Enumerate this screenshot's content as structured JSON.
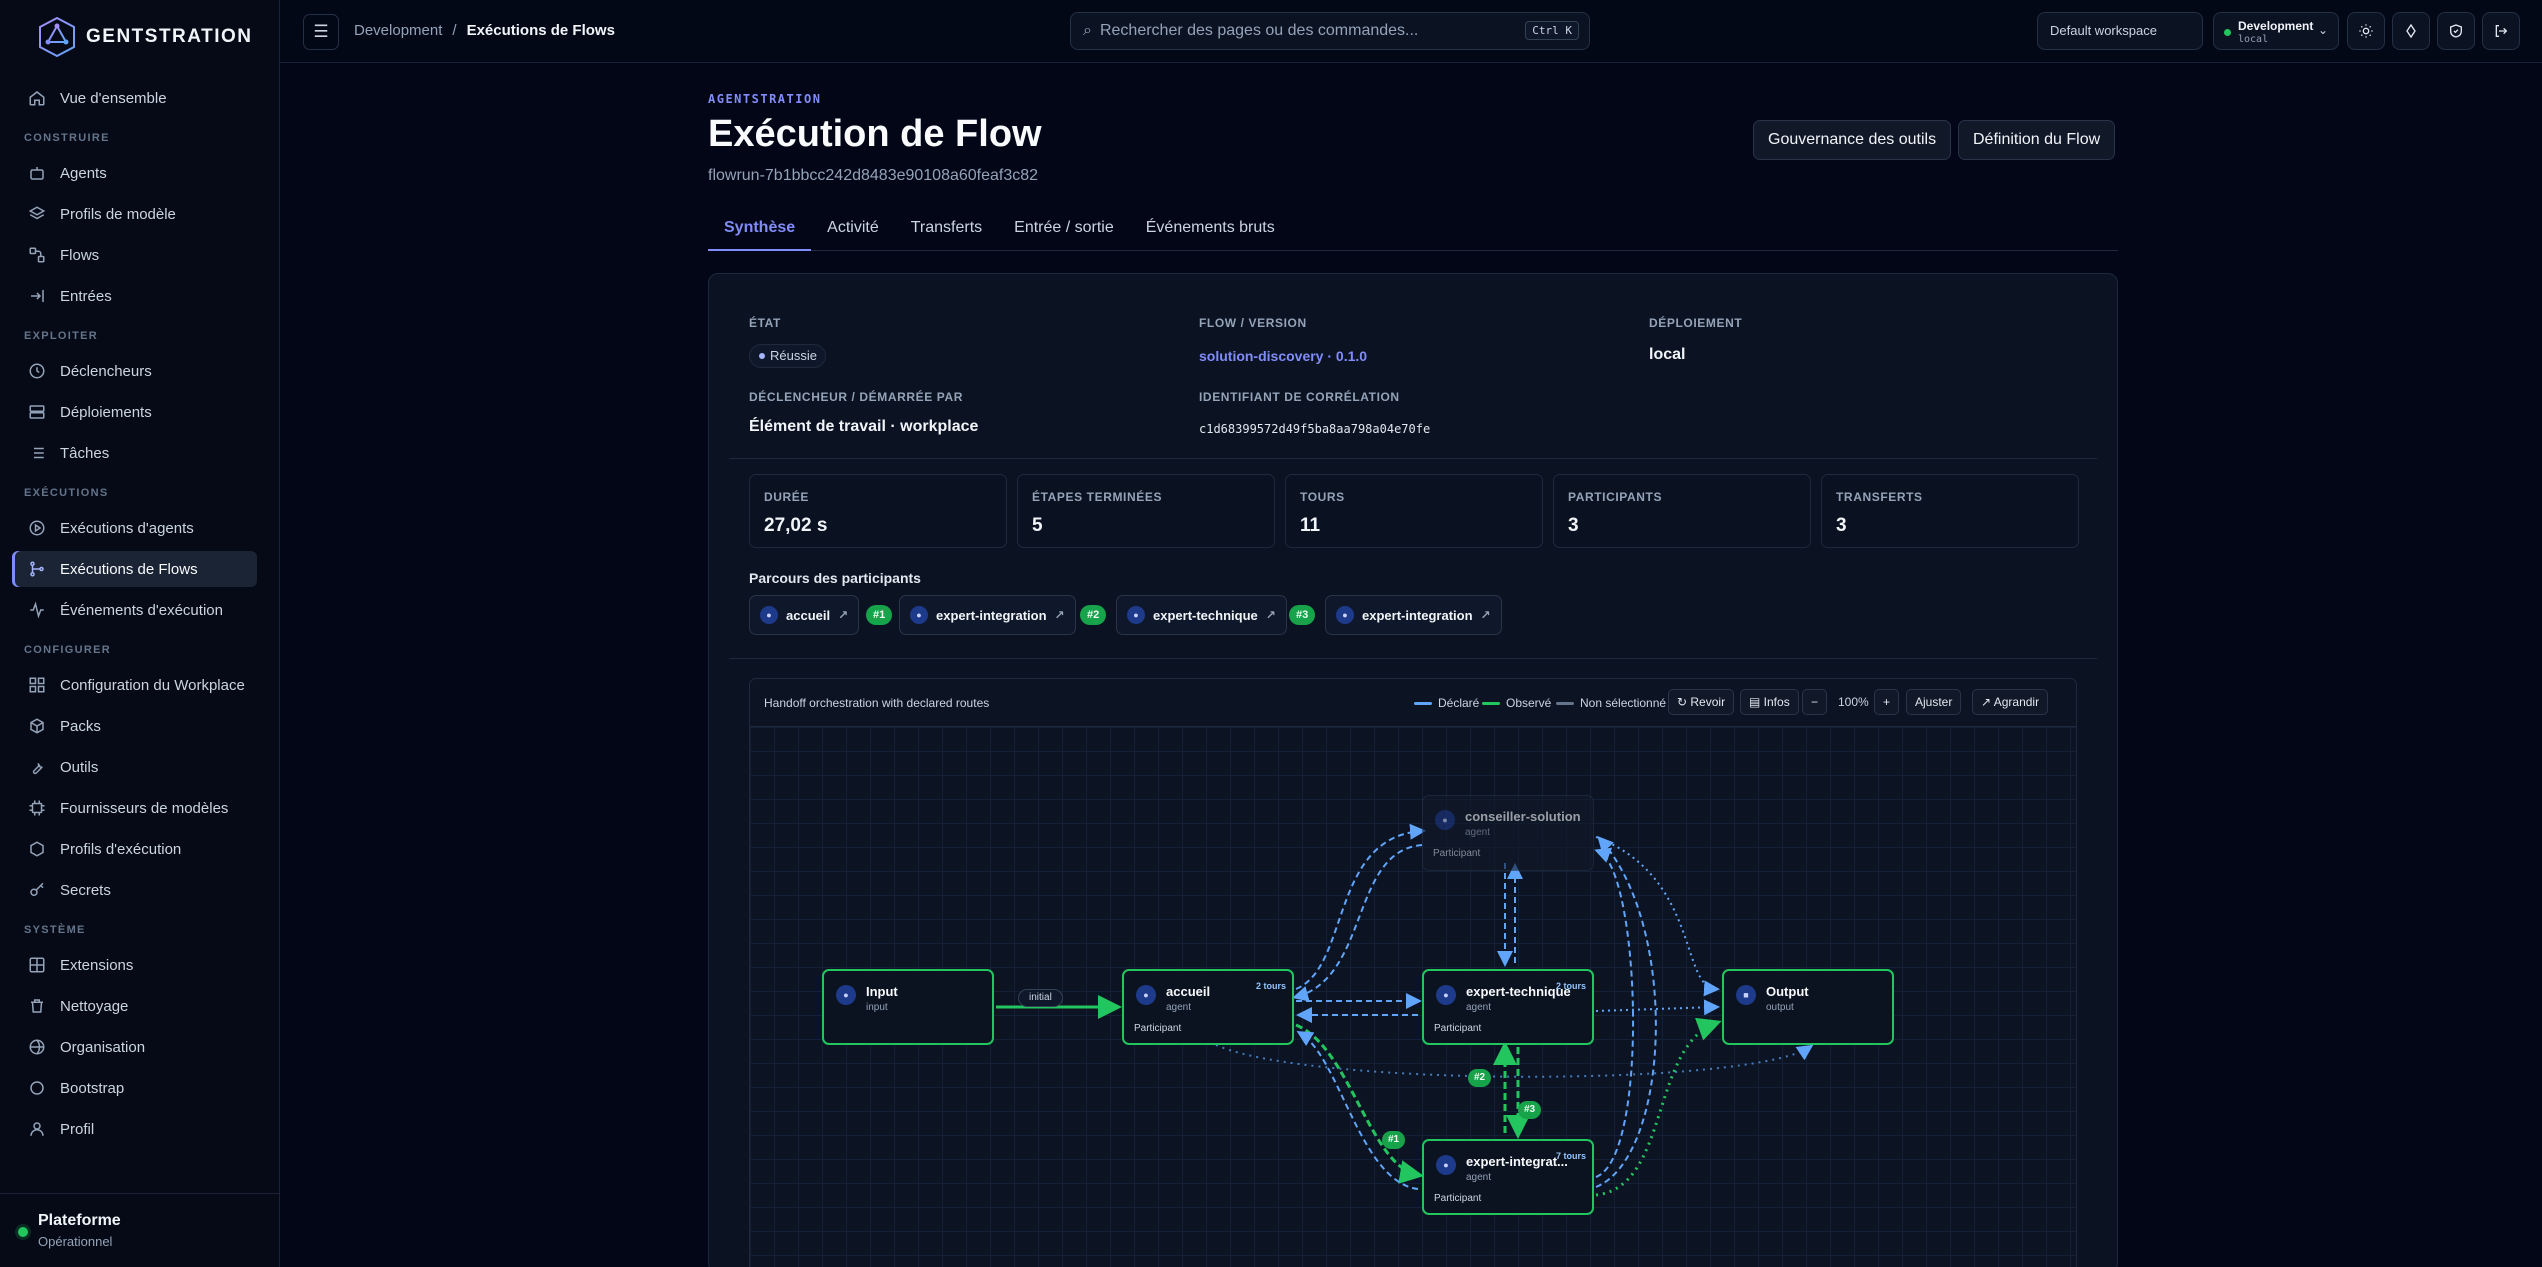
{
  "brand": {
    "name": "GENTSTRATION"
  },
  "sidebar": {
    "top": [
      {
        "label": "Vue d'ensemble",
        "icon": "home-icon"
      }
    ],
    "sections": [
      {
        "title": "CONSTRUIRE",
        "items": [
          {
            "label": "Agents",
            "icon": "bot-icon"
          },
          {
            "label": "Profils de modèle",
            "icon": "layers-icon"
          },
          {
            "label": "Flows",
            "icon": "workflow-icon"
          },
          {
            "label": "Entrées",
            "icon": "log-in-icon"
          }
        ]
      },
      {
        "title": "EXPLOITER",
        "items": [
          {
            "label": "Déclencheurs",
            "icon": "clock-icon"
          },
          {
            "label": "Déploiements",
            "icon": "server-icon"
          },
          {
            "label": "Tâches",
            "icon": "list-icon"
          }
        ]
      },
      {
        "title": "EXÉCUTIONS",
        "items": [
          {
            "label": "Exécutions d'agents",
            "icon": "play-circle-icon"
          },
          {
            "label": "Exécutions de Flows",
            "icon": "git-branch-icon",
            "active": true
          },
          {
            "label": "Événements d'exécution",
            "icon": "activity-icon"
          }
        ]
      },
      {
        "title": "CONFIGURER",
        "items": [
          {
            "label": "Configuration du Workplace",
            "icon": "grid-icon"
          },
          {
            "label": "Packs",
            "icon": "package-icon"
          },
          {
            "label": "Outils",
            "icon": "wrench-icon"
          },
          {
            "label": "Fournisseurs de modèles",
            "icon": "cpu-icon"
          },
          {
            "label": "Profils d'exécution",
            "icon": "box-icon"
          },
          {
            "label": "Secrets",
            "icon": "key-icon"
          }
        ]
      },
      {
        "title": "SYSTÈME",
        "items": [
          {
            "label": "Extensions",
            "icon": "puzzle-icon"
          },
          {
            "label": "Nettoyage",
            "icon": "trash-icon"
          },
          {
            "label": "Organisation",
            "icon": "building-icon"
          },
          {
            "label": "Bootstrap",
            "icon": "circle-icon"
          },
          {
            "label": "Profil",
            "icon": "user-icon"
          }
        ]
      }
    ],
    "platform": {
      "name": "Plateforme",
      "status": "Opérationnel"
    }
  },
  "topbar": {
    "menu_glyph": "☰",
    "breadcrumb": {
      "parent": "Development",
      "sep": "/",
      "current": "Exécutions de Flows"
    },
    "search": {
      "placeholder": "Rechercher des pages ou des commandes...",
      "glyph": "⌕",
      "shortcut": "Ctrl K"
    },
    "workspace": "Default workspace",
    "environment": {
      "name": "Development",
      "sub": "local",
      "chevron": "⌄"
    }
  },
  "page": {
    "eyebrow": "AGENTSTRATION",
    "title": "Exécution de Flow",
    "run_id": "flowrun-7b1bbcc242d8483e90108a60feaf3c82",
    "actions": {
      "governance": "Gouvernance des outils",
      "definition": "Définition du Flow"
    },
    "tabs": [
      "Synthèse",
      "Activité",
      "Transferts",
      "Entrée / sortie",
      "Événements bruts"
    ]
  },
  "details": {
    "state_label": "ÉTAT",
    "state_value": "Réussie",
    "flow_label": "FLOW / VERSION",
    "flow_value": "solution-discovery · 0.1.0",
    "deploy_label": "DÉPLOIEMENT",
    "deploy_value": "local",
    "trigger_label": "DÉCLENCHEUR / DÉMARRÉE PAR",
    "trigger_value": "Élément de travail · workplace",
    "corr_label": "IDENTIFIANT DE CORRÉLATION",
    "corr_value": "c1d68399572d49f5ba8aa798a04e70fe"
  },
  "stats": [
    {
      "label": "DURÉE",
      "value": "27,02 s"
    },
    {
      "label": "ÉTAPES TERMINÉES",
      "value": "5"
    },
    {
      "label": "TOURS",
      "value": "11"
    },
    {
      "label": "PARTICIPANTS",
      "value": "3"
    },
    {
      "label": "TRANSFERTS",
      "value": "3"
    }
  ],
  "journey": {
    "title": "Parcours des participants",
    "arrow_glyph": "↗",
    "chips": [
      "accueil",
      "expert-integration",
      "expert-technique",
      "expert-integration"
    ],
    "steps": [
      "#1",
      "#2",
      "#3"
    ]
  },
  "graph": {
    "title": "Handoff orchestration with declared routes",
    "legend": {
      "declared": "Déclaré",
      "observed": "Observé",
      "unselected": "Non sélectionné"
    },
    "buttons": {
      "review": "↻ Revoir",
      "info": "▤ Infos",
      "zoom_out": "−",
      "zoom": "100%",
      "zoom_in": "+",
      "fit": "Ajuster",
      "expand": "↗ Agrandir"
    },
    "colors": {
      "declared": "#60a5fa",
      "observed": "#22c55e",
      "unselected": "#64748b"
    },
    "edge_label": "initial",
    "edge_steps": [
      "#1",
      "#2",
      "#3"
    ],
    "nodes": {
      "input": {
        "name": "Input",
        "type": "input"
      },
      "accueil": {
        "name": "accueil",
        "type": "agent",
        "role": "Participant",
        "tours": "2 tours"
      },
      "conseiller": {
        "name": "conseiller-solution",
        "type": "agent",
        "role": "Participant"
      },
      "tech": {
        "name": "expert-technique",
        "type": "agent",
        "role": "Participant",
        "tours": "2 tours"
      },
      "output": {
        "name": "Output",
        "type": "output"
      },
      "integ": {
        "name": "expert-integrat...",
        "type": "agent",
        "role": "Participant",
        "tours": "7 tours"
      }
    }
  }
}
